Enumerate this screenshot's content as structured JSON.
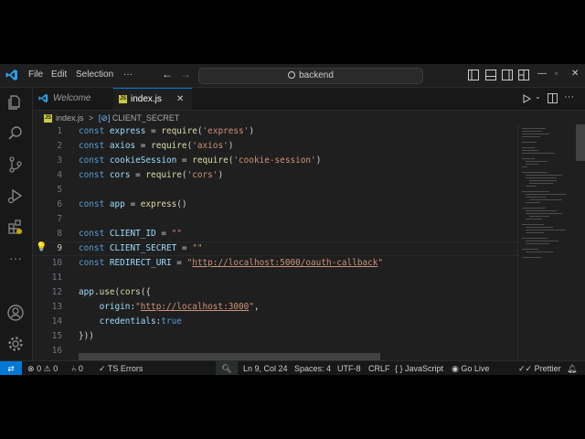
{
  "menu": {
    "file": "File",
    "edit": "Edit",
    "selection": "Selection",
    "more": "···"
  },
  "search": {
    "label": "backend"
  },
  "tabs": [
    {
      "label": "Welcome",
      "active": false
    },
    {
      "label": "index.js",
      "active": true
    }
  ],
  "breadcrumb": {
    "file": "index.js",
    "sep": ">",
    "symbol": "CLIENT_SECRET"
  },
  "code_lines": [
    {
      "n": "1"
    },
    {
      "n": "2"
    },
    {
      "n": "3"
    },
    {
      "n": "4"
    },
    {
      "n": "5"
    },
    {
      "n": "6"
    },
    {
      "n": "7"
    },
    {
      "n": "8"
    },
    {
      "n": "9"
    },
    {
      "n": "10"
    },
    {
      "n": "11"
    },
    {
      "n": "12"
    },
    {
      "n": "13"
    },
    {
      "n": "14"
    },
    {
      "n": "15"
    },
    {
      "n": "16"
    }
  ],
  "code": {
    "const": "const",
    "express_var": "express",
    "express_mod": "'express'",
    "axios_var": "axios",
    "axios_mod": "'axios'",
    "cookie_var": "cookieSession",
    "cookie_mod": "'cookie-session'",
    "cors_var": "cors",
    "cors_mod": "'cors'",
    "require": "require",
    "app_var": "app",
    "express_call": "express",
    "client_id": "CLIENT_ID",
    "client_secret": "CLIENT_SECRET",
    "redirect_uri": "REDIRECT_URI",
    "empty_str": "\"\"",
    "redirect_url": "http://localhost:5000/oauth-callback",
    "app_use": "app",
    "use": "use",
    "cors_call": "cors",
    "origin": "origin",
    "origin_url": "http://localhost:3000",
    "credentials": "credentials",
    "true": "true"
  },
  "status": {
    "errors": "0",
    "warnings": "0",
    "ports": "0",
    "ts_errors": "TS Errors",
    "position": "Ln 9, Col 24",
    "spaces": "Spaces: 4",
    "encoding": "UTF-8",
    "eol": "CRLF",
    "language_braces": "{ }",
    "language": "JavaScript",
    "golive": "Go Live",
    "prettier": "Prettier"
  },
  "colors": {
    "accent": "#0078d4",
    "bg": "#1f1f1f",
    "keyword": "#569cd6",
    "string": "#ce9178",
    "variable": "#9cdcfe",
    "function": "#dcdcaa"
  }
}
